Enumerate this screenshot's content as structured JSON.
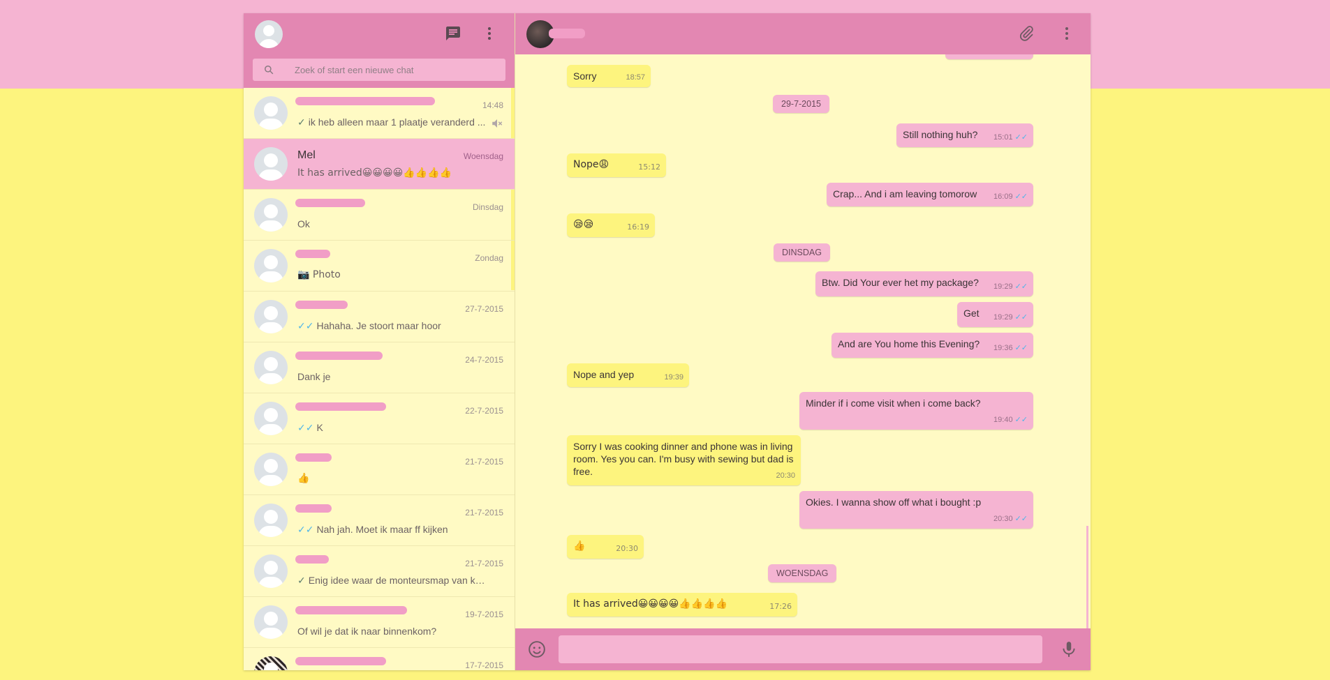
{
  "search": {
    "placeholder": "Zoek of start een nieuwe chat"
  },
  "chats": [
    {
      "name": "",
      "time": "14:48",
      "preview": "ik heb alleen maar 1 plaatje veranderd ...",
      "tick": "single",
      "muted": true
    },
    {
      "name": "Mel",
      "time": "Woensdag",
      "preview": "It has arrived😀😀😀😀👍👍👍👍",
      "tick": "",
      "active": true
    },
    {
      "name": "",
      "time": "Dinsdag",
      "preview": "Ok",
      "tick": ""
    },
    {
      "name": "",
      "time": "Zondag",
      "preview": "📷 Photo",
      "tick": ""
    },
    {
      "name": "",
      "time": "27-7-2015",
      "preview": "Hahaha. Je stoort maar hoor",
      "tick": "double"
    },
    {
      "name": "",
      "time": "24-7-2015",
      "preview": "Dank je",
      "tick": ""
    },
    {
      "name": "",
      "time": "22-7-2015",
      "preview": "K",
      "tick": "double"
    },
    {
      "name": "",
      "time": "21-7-2015",
      "preview": "👍",
      "tick": ""
    },
    {
      "name": "",
      "time": "21-7-2015",
      "preview": "Nah jah. Moet ik maar ff kijken",
      "tick": "double"
    },
    {
      "name": "",
      "time": "21-7-2015",
      "preview": "Enig idee waar de monteursmap van kog...",
      "tick": "single"
    },
    {
      "name": "",
      "time": "19-7-2015",
      "preview": "Of wil je dat ik naar binnenkom?",
      "tick": ""
    },
    {
      "name": "",
      "time": "17-7-2015",
      "preview": "",
      "tick": ""
    }
  ],
  "messages": {
    "m1": {
      "text": "Sorry",
      "time": "18:57"
    },
    "d1": "29-7-2015",
    "m2": {
      "text": "Still nothing huh?",
      "time": "15:01"
    },
    "m3": {
      "text": "Nope😩",
      "time": "15:12"
    },
    "m4": {
      "text": "Crap... And i am leaving tomorow",
      "time": "16:09"
    },
    "m5": {
      "text": "😪😪",
      "time": "16:19"
    },
    "d2": "DINSDAG",
    "m6": {
      "text": "Btw. Did Your ever het my package?",
      "time": "19:29"
    },
    "m7": {
      "text": "Get",
      "time": "19:29"
    },
    "m8": {
      "text": "And are You home this Evening?",
      "time": "19:36"
    },
    "m9": {
      "text": "Nope and yep",
      "time": "19:39"
    },
    "m10": {
      "text": "Minder if i come visit when i come back?",
      "time": "19:40"
    },
    "m11": {
      "text": "Sorry I was cooking dinner and phone was in living room. Yes you can. I'm busy with sewing but dad is free.",
      "time": "20:30"
    },
    "m12": {
      "text": "Okies. I wanna show off what i bought :p",
      "time": "20:30"
    },
    "m13": {
      "text": "👍",
      "time": "20:30"
    },
    "d3": "WOENSDAG",
    "m14": {
      "text": "It has arrived😀😀😀😀👍👍👍👍",
      "time": "17:26"
    }
  },
  "icons": {
    "new_chat": "chat-icon",
    "menu": "more-vertical-icon",
    "attach": "paperclip-icon",
    "emoji": "smiley-icon",
    "mic": "microphone-icon",
    "search": "search-icon",
    "mute": "muted-speaker-icon"
  },
  "colors": {
    "header": "#e387b2",
    "pink_light": "#f5b4d2",
    "yellow": "#fdf47e",
    "pane": "#fffac4",
    "read_tick": "#4fb5e8"
  }
}
